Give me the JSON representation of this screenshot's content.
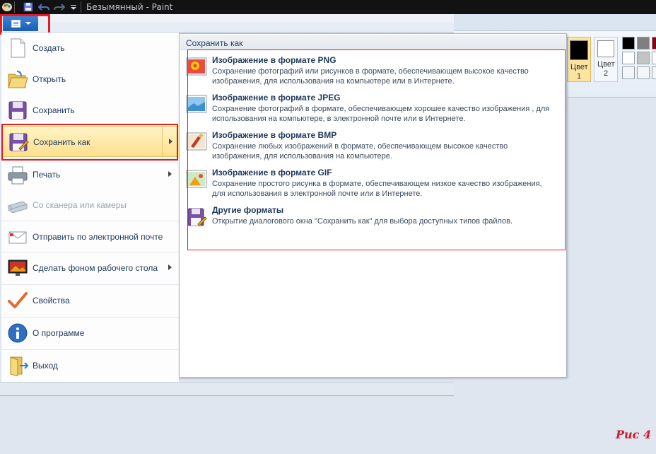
{
  "window": {
    "title": "Безымянный - Paint"
  },
  "app_menu": {
    "items": [
      {
        "label": "Создать",
        "icon": "new-document-icon",
        "enabled": true,
        "submenu": false
      },
      {
        "label": "Открыть",
        "icon": "open-folder-icon",
        "enabled": true,
        "submenu": false
      },
      {
        "label": "Сохранить",
        "icon": "save-icon",
        "enabled": true,
        "submenu": false
      },
      {
        "label": "Сохранить как",
        "icon": "save-as-icon",
        "enabled": true,
        "submenu": true,
        "selected": true
      },
      {
        "label": "Печать",
        "icon": "printer-icon",
        "enabled": true,
        "submenu": true
      },
      {
        "label": "Со сканера или камеры",
        "icon": "scanner-icon",
        "enabled": false,
        "submenu": false
      },
      {
        "label": "Отправить по электронной почте",
        "icon": "email-icon",
        "enabled": true,
        "submenu": false
      },
      {
        "label": "Сделать фоном рабочего стола",
        "icon": "desktop-background-icon",
        "enabled": true,
        "submenu": true
      },
      {
        "label": "Свойства",
        "icon": "checkmark-icon",
        "enabled": true,
        "submenu": false
      },
      {
        "label": "О программе",
        "icon": "info-icon",
        "enabled": true,
        "submenu": false
      },
      {
        "label": "Выход",
        "icon": "exit-icon",
        "enabled": true,
        "submenu": false
      }
    ]
  },
  "save_as": {
    "header": "Сохранить как",
    "formats": [
      {
        "title": "Изображение в формате PNG",
        "description": "Сохранение фотографий или рисунков в формате, обеспечивающем высокое качество изображения, для использования на компьютере или в Интернете.",
        "icon": "png-image-icon"
      },
      {
        "title": "Изображение в формате JPEG",
        "description": "Сохранение фотографий в формате, обеспечивающем хорошее качество изображения , для использования на компьютере, в электронной почте или в Интернете.",
        "icon": "jpeg-image-icon"
      },
      {
        "title": "Изображение в формате BMP",
        "description": "Сохранение любых изображений в формате, обеспечивающем высокое качество изображения, для использования на компьютере.",
        "icon": "bmp-image-icon"
      },
      {
        "title": "Изображение в формате GIF",
        "description": "Сохранение простого рисунка в формате, обеспечивающем низкое качество изображения, для использования в электронной почте или в Интернете.",
        "icon": "gif-image-icon"
      },
      {
        "title": "Другие форматы",
        "description": "Открытие диалогового окна \"Сохранить как\" для выбора доступных типов файлов.",
        "icon": "other-formats-icon"
      }
    ]
  },
  "ribbon": {
    "color1_label": "Цвет 1",
    "color2_label": "Цвет 2",
    "color1": "#000000",
    "color2": "#ffffff",
    "palette": [
      "#000000",
      "#7f7f7f",
      "#880015",
      "#ffffff",
      "#c3c3c3",
      "#ffffff",
      "#ffffff",
      "#ffffff",
      "#ffffff"
    ]
  },
  "annotation": {
    "figure_label": "Рис 4",
    "highlight_color": "#e21b24"
  }
}
